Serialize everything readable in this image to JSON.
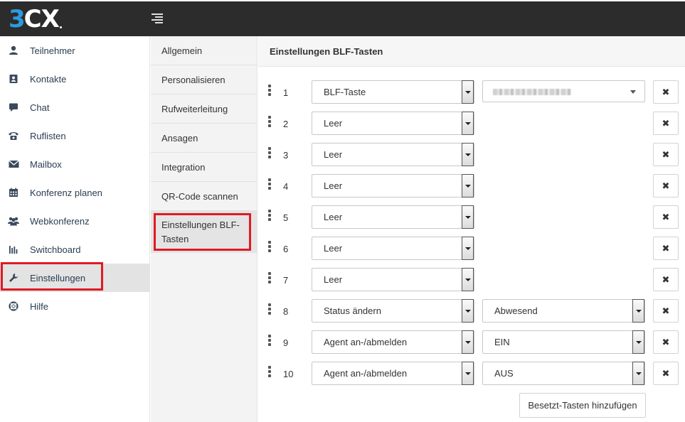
{
  "app": {
    "logo_num": "3",
    "logo_text": "CX"
  },
  "sidebar": {
    "items": [
      {
        "label": "Teilnehmer",
        "icon": "user-icon"
      },
      {
        "label": "Kontakte",
        "icon": "address-book-icon"
      },
      {
        "label": "Chat",
        "icon": "chat-bubble-icon"
      },
      {
        "label": "Ruflisten",
        "icon": "phone-icon"
      },
      {
        "label": "Mailbox",
        "icon": "envelope-icon"
      },
      {
        "label": "Konferenz planen",
        "icon": "calendar-icon"
      },
      {
        "label": "Webkonferenz",
        "icon": "users-icon"
      },
      {
        "label": "Switchboard",
        "icon": "bar-chart-icon"
      },
      {
        "label": "Einstellungen",
        "icon": "wrench-icon"
      },
      {
        "label": "Hilfe",
        "icon": "lifebuoy-icon"
      }
    ],
    "active": "Einstellungen"
  },
  "subnav": {
    "items": [
      {
        "label": "Allgemein"
      },
      {
        "label": "Personalisieren"
      },
      {
        "label": "Rufweiterleitung"
      },
      {
        "label": "Ansagen"
      },
      {
        "label": "Integration"
      },
      {
        "label": "QR-Code scannen"
      },
      {
        "label": "Einstellungen BLF-Tasten"
      }
    ],
    "active": "Einstellungen BLF-Tasten"
  },
  "main": {
    "title": "Einstellungen BLF-Tasten",
    "rows": [
      {
        "num": "1",
        "type": "BLF-Taste",
        "value": "",
        "value_kind": "blurred-combo"
      },
      {
        "num": "2",
        "type": "Leer",
        "value": "",
        "value_kind": "none"
      },
      {
        "num": "3",
        "type": "Leer",
        "value": "",
        "value_kind": "none"
      },
      {
        "num": "4",
        "type": "Leer",
        "value": "",
        "value_kind": "none"
      },
      {
        "num": "5",
        "type": "Leer",
        "value": "",
        "value_kind": "none"
      },
      {
        "num": "6",
        "type": "Leer",
        "value": "",
        "value_kind": "none"
      },
      {
        "num": "7",
        "type": "Leer",
        "value": "",
        "value_kind": "none"
      },
      {
        "num": "8",
        "type": "Status ändern",
        "value": "Abwesend",
        "value_kind": "select"
      },
      {
        "num": "9",
        "type": "Agent an-/abmelden",
        "value": "EIN",
        "value_kind": "select"
      },
      {
        "num": "10",
        "type": "Agent an-/abmelden",
        "value": "AUS",
        "value_kind": "select"
      }
    ],
    "delete_symbol": "✖",
    "add_button": "Besetzt-Tasten hinzufügen"
  },
  "colors": {
    "topbar": "#2c2c2c",
    "logo_blue": "#2b9be0",
    "highlight": "#e01a24",
    "sidebar_text": "#2b3d52"
  }
}
